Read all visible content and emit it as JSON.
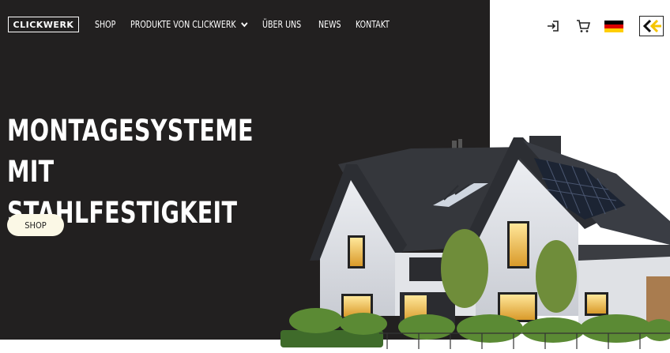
{
  "brand": {
    "logo_text": "CLICKWERK"
  },
  "nav": {
    "items": [
      {
        "label": "SHOP"
      },
      {
        "label": "PRODUKTE VON CLICKWERK",
        "has_dropdown": true
      },
      {
        "label": "ÜBER UNS"
      },
      {
        "label": "NEWS"
      },
      {
        "label": "KONTAKT"
      }
    ]
  },
  "header_icons": {
    "login": "login-icon",
    "cart": "cart-icon",
    "language": "flag-de-icon",
    "back": "back-arrow-icon"
  },
  "hero": {
    "headline_line1": "MONTAGESYSTEME MIT",
    "headline_line2": "STAHLFESTIGKEIT",
    "cta_label": "SHOP",
    "image": "house-with-solar-panels"
  },
  "colors": {
    "hero_bg": "#222020",
    "cta_bg": "#fbf8e6",
    "accent_yellow": "#f5c400",
    "flag_black": "#000000",
    "flag_red": "#dd0000",
    "flag_gold": "#ffce00"
  }
}
